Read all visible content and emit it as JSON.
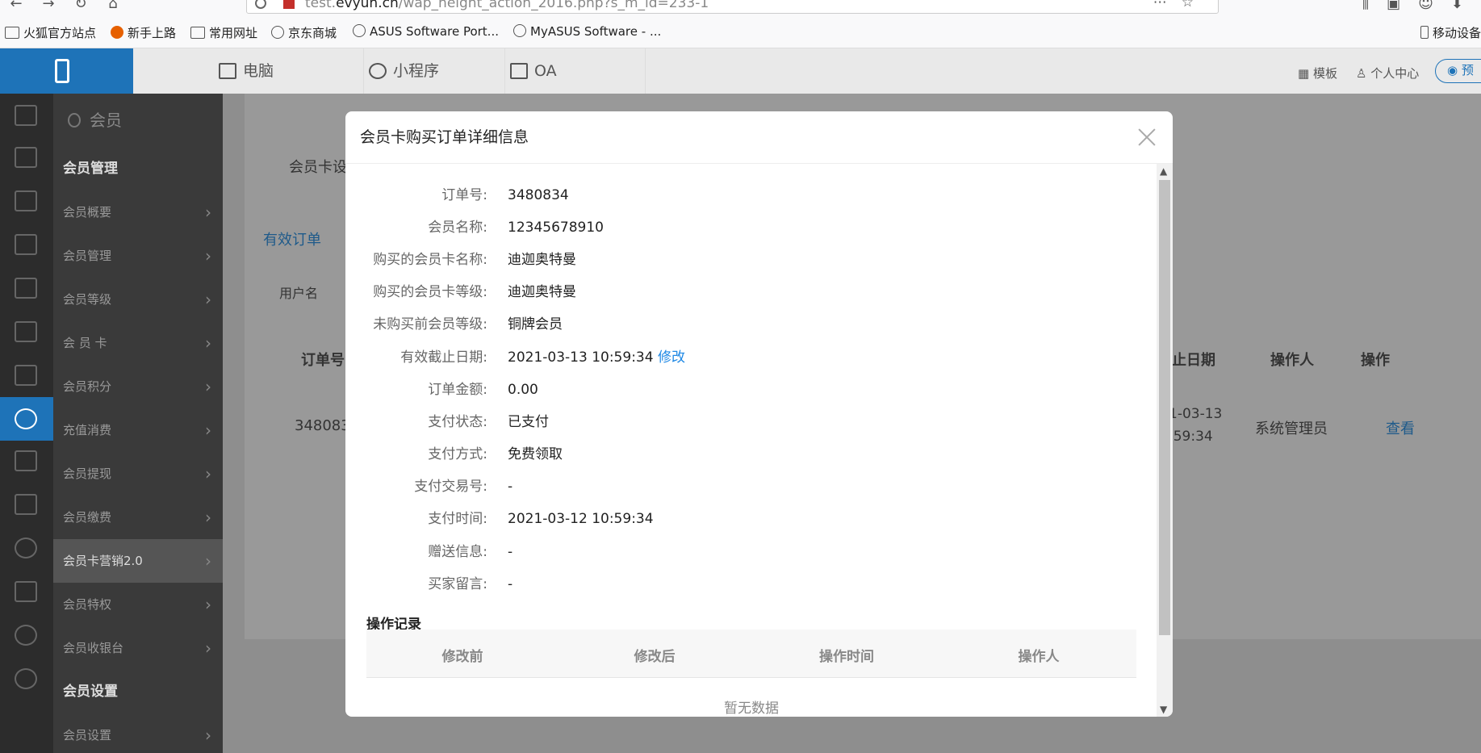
{
  "browser": {
    "url_prefix": "test.",
    "url_domain": "evyun.cn",
    "url_path": "/wap_height_action_2016.php?s_m_id=233-1",
    "bookmarks": [
      {
        "label": "火狐官方站点",
        "icon": "folder-icon"
      },
      {
        "label": "新手上路",
        "icon": "firefox-icon"
      },
      {
        "label": "常用网址",
        "icon": "folder-icon"
      },
      {
        "label": "京东商城",
        "icon": "globe-icon"
      },
      {
        "label": "ASUS Software Port...",
        "icon": "globe-icon"
      },
      {
        "label": "MyASUS Software - ...",
        "icon": "globe-icon"
      },
      {
        "label": "移动设备",
        "icon": "phone-icon"
      }
    ]
  },
  "header": {
    "tabs": [
      {
        "label": "电脑",
        "icon": "monitor-icon"
      },
      {
        "label": "小程序",
        "icon": "link-icon"
      },
      {
        "label": "OA",
        "icon": "calendar-icon"
      }
    ],
    "template_label": "模板",
    "user_center_label": "个人中心",
    "preview_label": "预"
  },
  "sidebar": {
    "title": "会员",
    "sections": [
      {
        "title": "会员管理",
        "items": [
          "会员概要",
          "会员管理",
          "会员等级",
          "会 员 卡",
          "会员积分",
          "充值消费",
          "会员提现",
          "会员缴费",
          "会员卡营销2.0",
          "会员特权",
          "会员收银台"
        ]
      },
      {
        "title": "会员设置",
        "items": [
          "会员设置"
        ]
      }
    ],
    "selected_item": "会员卡营销2.0"
  },
  "background": {
    "tab_label": "会员卡设",
    "subtab_label": "有效订单",
    "filter_placeholder": "用户名",
    "col_order_no": "订单号",
    "col_end_date": "止日期",
    "col_operator": "操作人",
    "col_action": "操作",
    "row_order_no": "348083",
    "row_date_1": "1-03-13",
    "row_date_2": ":59:34",
    "row_operator": "系统管理员",
    "row_action": "查看"
  },
  "modal": {
    "title": "会员卡购买订单详细信息",
    "fields": [
      {
        "label": "订单号:",
        "value": "3480834"
      },
      {
        "label": "会员名称:",
        "value": "12345678910"
      },
      {
        "label": "购买的会员卡名称:",
        "value": "迪迦奥特曼"
      },
      {
        "label": "购买的会员卡等级:",
        "value": "迪迦奥特曼"
      },
      {
        "label": "未购买前会员等级:",
        "value": "铜牌会员"
      },
      {
        "label": "有效截止日期:",
        "value": "2021-03-13 10:59:34",
        "link": "修改"
      },
      {
        "label": "订单金额:",
        "value": "0.00"
      },
      {
        "label": "支付状态:",
        "value": "已支付"
      },
      {
        "label": "支付方式:",
        "value": "免费领取"
      },
      {
        "label": "支付交易号:",
        "value": "-"
      },
      {
        "label": "支付时间:",
        "value": "2021-03-12 10:59:34"
      },
      {
        "label": "赠送信息:",
        "value": "-"
      },
      {
        "label": "买家留言:",
        "value": "-"
      }
    ],
    "records_title": "操作记录",
    "records_columns": [
      "修改前",
      "修改后",
      "操作时间",
      "操作人"
    ],
    "records_empty": "暂无数据"
  }
}
